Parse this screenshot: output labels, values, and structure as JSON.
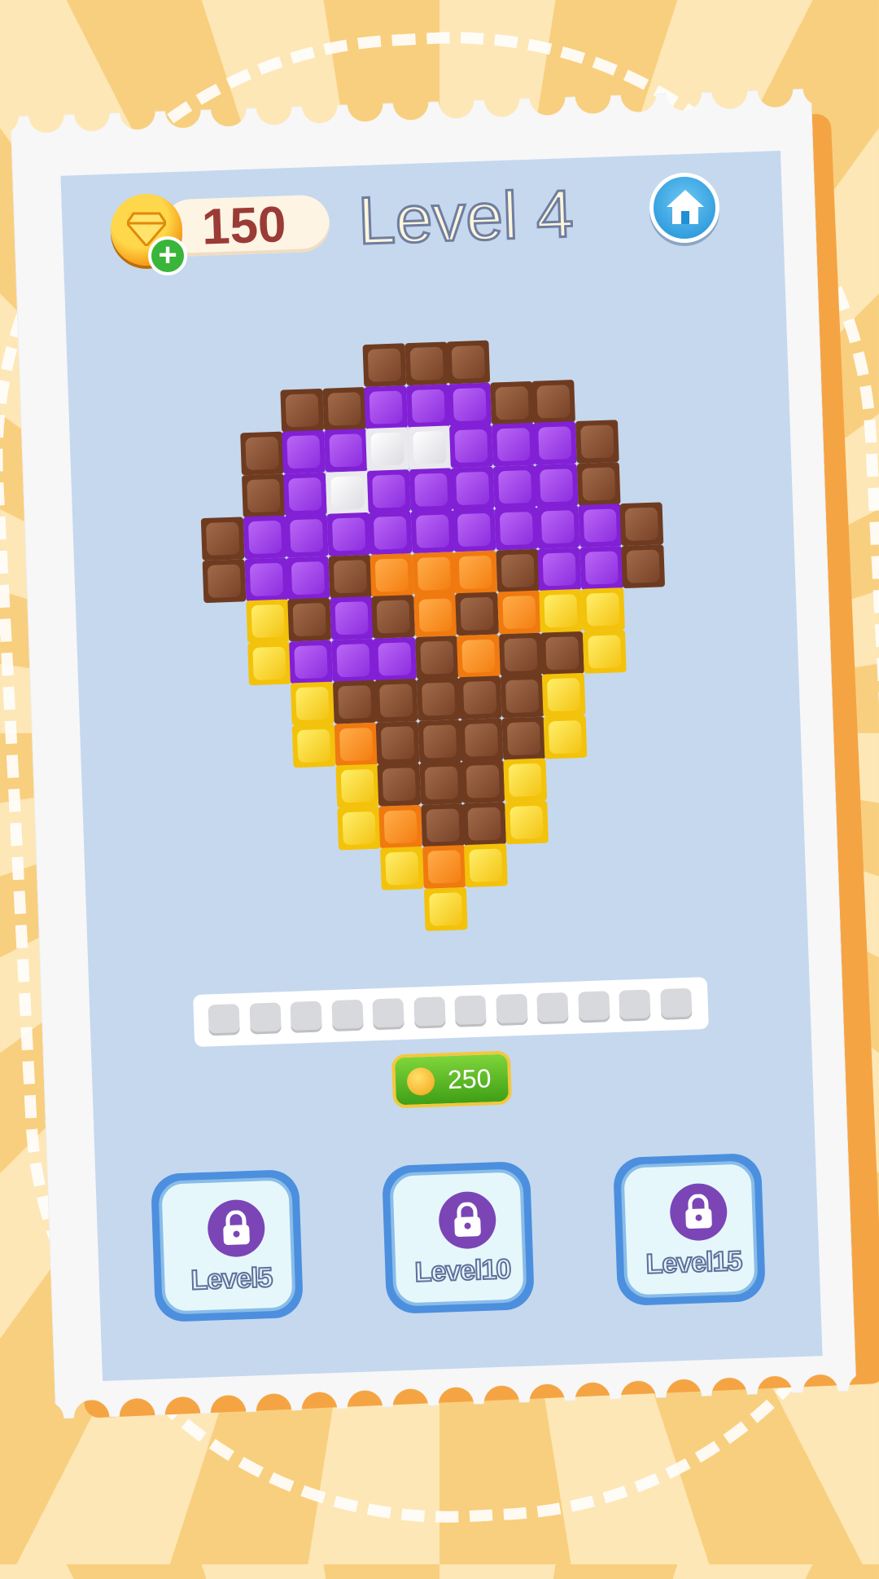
{
  "header": {
    "coins": "150",
    "level_title": "Level 4"
  },
  "icons": {
    "coin": "gem-coin-icon",
    "add": "plus-icon",
    "home": "home-icon",
    "lock": "lock-icon"
  },
  "colors": {
    "brown": "#6e3b20",
    "purple": "#8120d4",
    "white": "#e9e9ee",
    "orange": "#f07a10",
    "yellow": "#f3c20a"
  },
  "artwork": {
    "rows": [
      "....BBB.....",
      "..BBPPPBB...",
      ".BPPWWPPPB..",
      ".BPWPPPPPB..",
      "BPPPPPPPPPB.",
      "BPPBOOOBPPB.",
      ".YBPBOBOYY..",
      ".YPPPBOBBY..",
      "..YBBBBBY...",
      "..YOBBBBY...",
      "...YBBBY....",
      "...YOBBY....",
      "....YOY.....",
      ".....Y......"
    ]
  },
  "progress": {
    "slots_total": 12,
    "slots_filled": 0
  },
  "buy_button": {
    "price": "250"
  },
  "levels": [
    {
      "label": "Level5",
      "locked": true
    },
    {
      "label": "Level10",
      "locked": true
    },
    {
      "label": "Level15",
      "locked": true
    }
  ]
}
